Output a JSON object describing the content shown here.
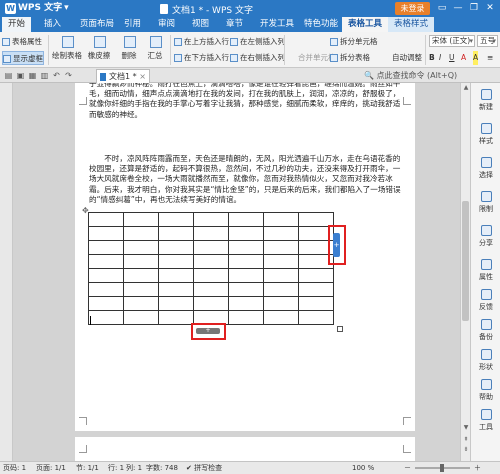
{
  "titlebar": {
    "app_name": "WPS 文字",
    "logo_letter": "W",
    "dropdown": "▾",
    "window_title": "文档1 * - WPS 文字",
    "signin_label": "未登录",
    "btn_skin": "▭",
    "btn_minimize": "—",
    "btn_restore": "❐",
    "btn_close": "✕"
  },
  "menu": {
    "tabs": [
      "开始",
      "插入",
      "页面布局",
      "引用",
      "审阅",
      "视图",
      "章节",
      "开发工具",
      "特色功能"
    ],
    "context_tabs": [
      "表格工具",
      "表格样式"
    ],
    "active_tab": "表格工具"
  },
  "ribbon": {
    "table_props": "表格属性",
    "show_grid": "显示虚框",
    "draw_table": "绘制表格",
    "eraser": "橡皮擦",
    "delete": "删除",
    "summary": "汇总",
    "insert_above": "在上方插入行",
    "insert_below": "在下方插入行",
    "insert_left": "在左侧插入列",
    "insert_right": "在右侧插入列",
    "merge_cells": "合并单元格",
    "split_cells": "拆分单元格",
    "split_table": "拆分表格",
    "autofit": "自动调整",
    "font_name": "宋体 (正文)",
    "font_size": "五号",
    "bold": "B",
    "italic": "I",
    "underline": "U",
    "font_color": "A",
    "highlight": "A",
    "align": "≡"
  },
  "docbar": {
    "doc_tab": "文档1 *",
    "close_x": "×",
    "search_placeholder": "点此查找命令 (Alt+Q)",
    "search_icon": "🔍"
  },
  "document": {
    "para1_partial": "子显得飘渺而神秘。雨打在芭蕉上，滴滴嗒嗒，像是谁在轻弹着琵琶，缠绵而温婉。雨丝如牛毛，细而动情，细声点点滴滴地打在我的发间，打在我的肌肤上，润润，凉凉的，舒服极了，就像你纤细的手指在我的手掌心写着字让我猜，那种感觉，细腻而柔软，痒痒的，挑动我舒适而敏感的神经。",
    "para2": "不时，凉风阵阵雨露而至，天色还是晴朗的，无风，阳光洒遍千山万水，走在乌语花香的校园里，还算是舒适的，起码不算很热，忽然间，不过几秒的功夫，还没来得及打开雨伞，一场大风就席卷全校，一场大雨就播然而至，就像你，忽而对我热情似火，又忽而对我冷若冰霜。后来，我才明白，你对我其实是“情比金坚”的，只是后来的后来，我们都陷入了一场错误的“情感纠葛”中，再也无法续写美好的情谊。",
    "table_rows": 8,
    "table_cols": 7,
    "add_column_symbol": "+",
    "add_row_symbol": "+"
  },
  "sidepanel": {
    "items": [
      "新建",
      "样式",
      "选择",
      "限制",
      "分享",
      "属性",
      "反馈",
      "备份",
      "形状",
      "帮助",
      "工具"
    ]
  },
  "status": {
    "page": "页码: 1",
    "pages": "页面: 1/1",
    "section": "节: 1/1",
    "row": "行: 1",
    "col": "列: 1",
    "words": "字数: 748",
    "spell": "拼写检查",
    "zoom": "100 %",
    "zoom_minus": "－",
    "zoom_plus": "＋"
  },
  "colors": {
    "title_blue": "#2b78c4",
    "highlight_red": "#e02020",
    "insert_handle_blue": "#3b7fd0"
  }
}
